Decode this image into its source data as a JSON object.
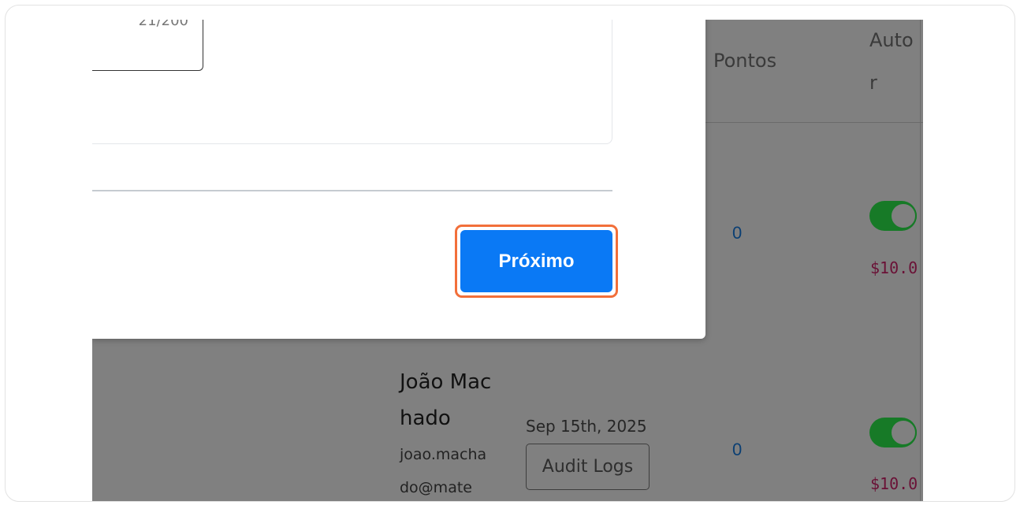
{
  "table": {
    "headers": {
      "points": "Pontos",
      "auto_line1": "Auto",
      "auto_line2": "r"
    },
    "rows": [
      {
        "points": "0",
        "price": "$10.0"
      },
      {
        "name": "João Machado",
        "email": "joao.machado@mate",
        "date": "Sep 15th, 2025",
        "audit_label": "Audit Logs",
        "points": "0",
        "price": "$10.0"
      }
    ]
  },
  "modal": {
    "char_counter": "21/200",
    "next_label": "Próximo"
  },
  "colors": {
    "primary_button": "#0a79f5",
    "highlight_ring": "#f26f3a",
    "toggle_on": "#177a27"
  }
}
